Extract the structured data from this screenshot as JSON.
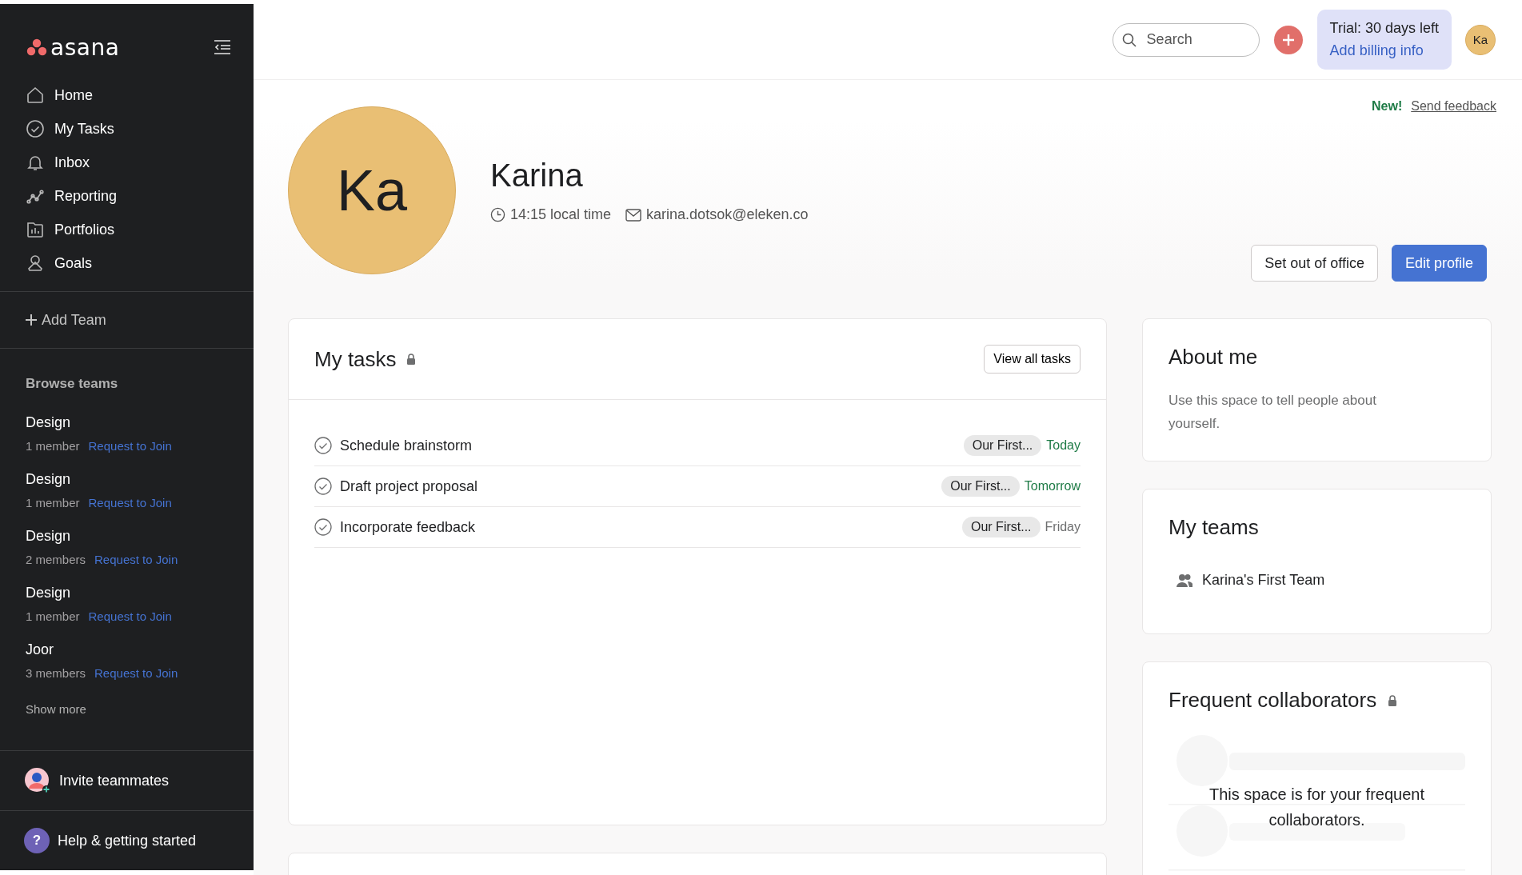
{
  "sidebar": {
    "logo": "asana",
    "nav": [
      {
        "label": "Home",
        "kind": "home"
      },
      {
        "label": "My Tasks",
        "kind": "check"
      },
      {
        "label": "Inbox",
        "kind": "bell"
      },
      {
        "label": "Reporting",
        "kind": "chart"
      },
      {
        "label": "Portfolios",
        "kind": "folder"
      },
      {
        "label": "Goals",
        "kind": "goal"
      }
    ],
    "add_team": "Add Team",
    "browse_title": "Browse teams",
    "teams": [
      {
        "name": "Design",
        "members": "1 member",
        "action": "Request to Join"
      },
      {
        "name": "Design",
        "members": "1 member",
        "action": "Request to Join"
      },
      {
        "name": "Design",
        "members": "2 members",
        "action": "Request to Join"
      },
      {
        "name": "Design",
        "members": "1 member",
        "action": "Request to Join"
      },
      {
        "name": "Joor",
        "members": "3 members",
        "action": "Request to Join"
      }
    ],
    "show_more": "Show more",
    "invite": "Invite teammates",
    "help": {
      "icon": "?",
      "label": "Help & getting started"
    }
  },
  "topbar": {
    "search": {
      "placeholder": "Search"
    },
    "trial": {
      "title": "Trial: 30 days left",
      "link": "Add billing info"
    },
    "avatar": "Ka"
  },
  "feedback": {
    "badge": "New!",
    "link": "Send feedback"
  },
  "profile": {
    "initials": "Ka",
    "name": "Karina",
    "local_time": "14:15 local time",
    "email": "karina.dotsok@eleken.co",
    "buttons": [
      "Set out of office",
      "Edit profile"
    ]
  },
  "my_tasks": {
    "title": "My tasks",
    "button": "View all tasks",
    "tasks": [
      {
        "name": "Schedule brainstorm",
        "project": "Our First...",
        "due": "Today",
        "color": "#1e7b46"
      },
      {
        "name": "Draft project proposal",
        "project": "Our First...",
        "due": "Tomorrow",
        "color": "#1e7b46"
      },
      {
        "name": "Incorporate feedback",
        "project": "Our First...",
        "due": "Friday",
        "color": "#6d6e6f"
      }
    ]
  },
  "about": {
    "title": "About me",
    "placeholder": "Use this space to tell people about yourself."
  },
  "my_teams": {
    "title": "My teams",
    "teams": [
      "Karina's First Team"
    ]
  },
  "collaborators": {
    "title": "Frequent collaborators",
    "empty": "This space is for your frequent collaborators."
  }
}
